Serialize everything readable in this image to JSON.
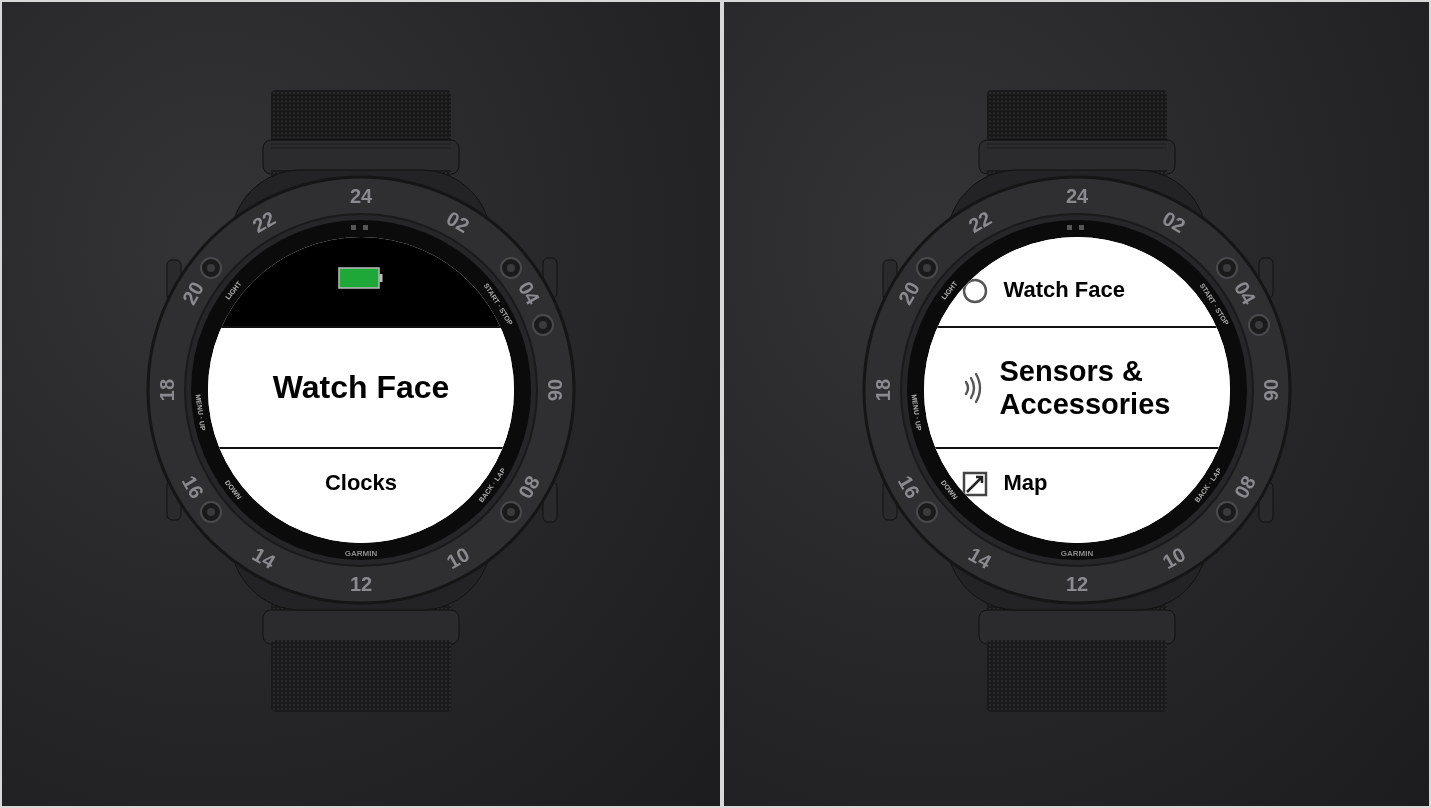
{
  "panels": [
    {
      "bezel": {
        "numbers": [
          "24",
          "02",
          "04",
          "06",
          "08",
          "10",
          "12",
          "14",
          "16",
          "18",
          "20",
          "22"
        ],
        "button_labels": [
          "LIGHT",
          "START · STOP",
          "MENU · UP",
          "BACK · LAP",
          "DOWN"
        ],
        "brand": "GARMIN"
      },
      "screen": {
        "rows": [
          {
            "kind": "status",
            "selected": false
          },
          {
            "kind": "plain",
            "label": "Watch Face",
            "selected": true
          },
          {
            "kind": "plain",
            "label": "Clocks",
            "selected": false
          }
        ]
      }
    },
    {
      "bezel": {
        "numbers": [
          "24",
          "02",
          "04",
          "06",
          "08",
          "10",
          "12",
          "14",
          "16",
          "18",
          "20",
          "22"
        ],
        "button_labels": [
          "LIGHT",
          "START · STOP",
          "MENU · UP",
          "BACK · LAP",
          "DOWN"
        ],
        "brand": "GARMIN"
      },
      "screen": {
        "rows": [
          {
            "kind": "watch",
            "label": "Watch Face",
            "selected": false
          },
          {
            "kind": "sensor",
            "label": "Sensors & Accessories",
            "selected": true
          },
          {
            "kind": "map",
            "label": "Map",
            "selected": false
          }
        ]
      }
    }
  ]
}
